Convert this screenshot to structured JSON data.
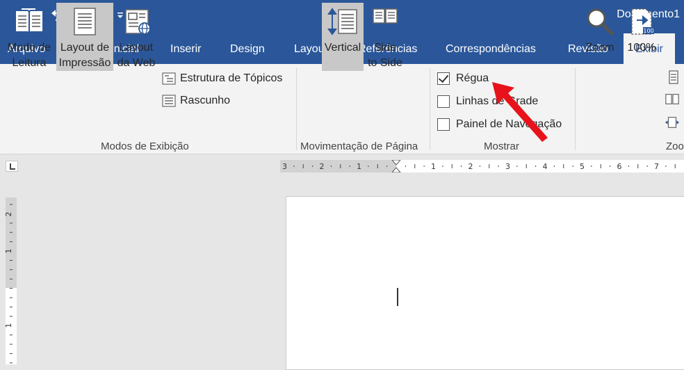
{
  "window": {
    "title": "Documento1"
  },
  "quick_access": {
    "icons": [
      "save-icon",
      "undo-icon",
      "redo-icon",
      "customize-icon"
    ]
  },
  "tabs": [
    "Arquivo",
    "Página Inicial",
    "Inserir",
    "Design",
    "Layout",
    "Referências",
    "Correspondências",
    "Revisão",
    "Exibir"
  ],
  "active_tab": "Exibir",
  "ribbon": {
    "modos": {
      "label": "Modos de Exibição",
      "leitura": [
        "Modo de",
        "Leitura"
      ],
      "impressao": [
        "Layout de",
        "Impressão"
      ],
      "web": [
        "Layout",
        "da Web"
      ],
      "estrutura": "Estrutura de Tópicos",
      "rascunho": "Rascunho"
    },
    "movimentacao": {
      "label": "Movimentação de Página",
      "vertical": "Vertical",
      "side": [
        "Side",
        "to Side"
      ]
    },
    "mostrar": {
      "label": "Mostrar",
      "regua": "Régua",
      "linhas": "Linhas de Grade",
      "painel": "Painel de Navegação"
    },
    "zoom": {
      "label": "Zoo",
      "zoom": "Zoom",
      "pct": "100%"
    }
  },
  "ruler": {
    "horizontal_labels": [
      "3",
      "2",
      "1",
      "1",
      "2",
      "3",
      "4",
      "5",
      "6",
      "7"
    ],
    "vertical_labels": [
      "2",
      "1",
      "1"
    ]
  },
  "colors": {
    "accent": "#2b579a",
    "ribbon": "#f3f3f3",
    "arrow": "#e8121a"
  }
}
